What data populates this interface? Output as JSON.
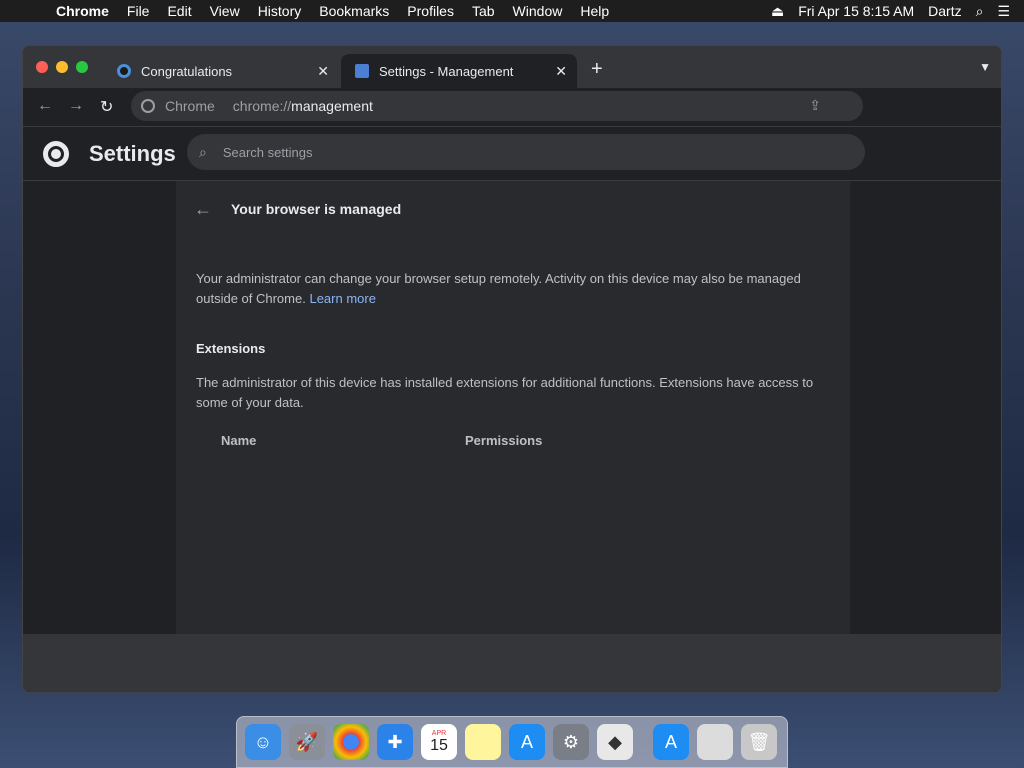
{
  "menubar": {
    "app": "Chrome",
    "items": [
      "File",
      "Edit",
      "View",
      "History",
      "Bookmarks",
      "Profiles",
      "Tab",
      "Window",
      "Help"
    ],
    "clock": "Fri Apr 15  8:15 AM",
    "user": "Dartz"
  },
  "tabs": [
    {
      "title": "Congratulations"
    },
    {
      "title": "Settings - Management"
    }
  ],
  "omnibox": {
    "site": "Chrome",
    "scheme": "chrome://",
    "path": "management"
  },
  "settings": {
    "title": "Settings",
    "search_placeholder": "Search settings"
  },
  "page": {
    "heading": "Your browser is managed",
    "intro": "Your administrator can change your browser setup remotely. Activity on this device may also be managed outside of Chrome.",
    "learn_more": "Learn more",
    "extensions_heading": "Extensions",
    "extensions_text": "The administrator of this device has installed extensions for additional functions. Extensions have access to some of your data.",
    "col_name": "Name",
    "col_permissions": "Permissions"
  },
  "dock": {
    "calendar_month": "APR",
    "calendar_day": "15",
    "apps": [
      "finder-icon",
      "launchpad-icon",
      "chrome-icon",
      "safari-icon",
      "calendar-icon",
      "notes-icon",
      "app-store-icon",
      "system-preferences-icon",
      "roblox-icon",
      "app-store-2-icon",
      "file-icon",
      "trash-icon"
    ]
  }
}
